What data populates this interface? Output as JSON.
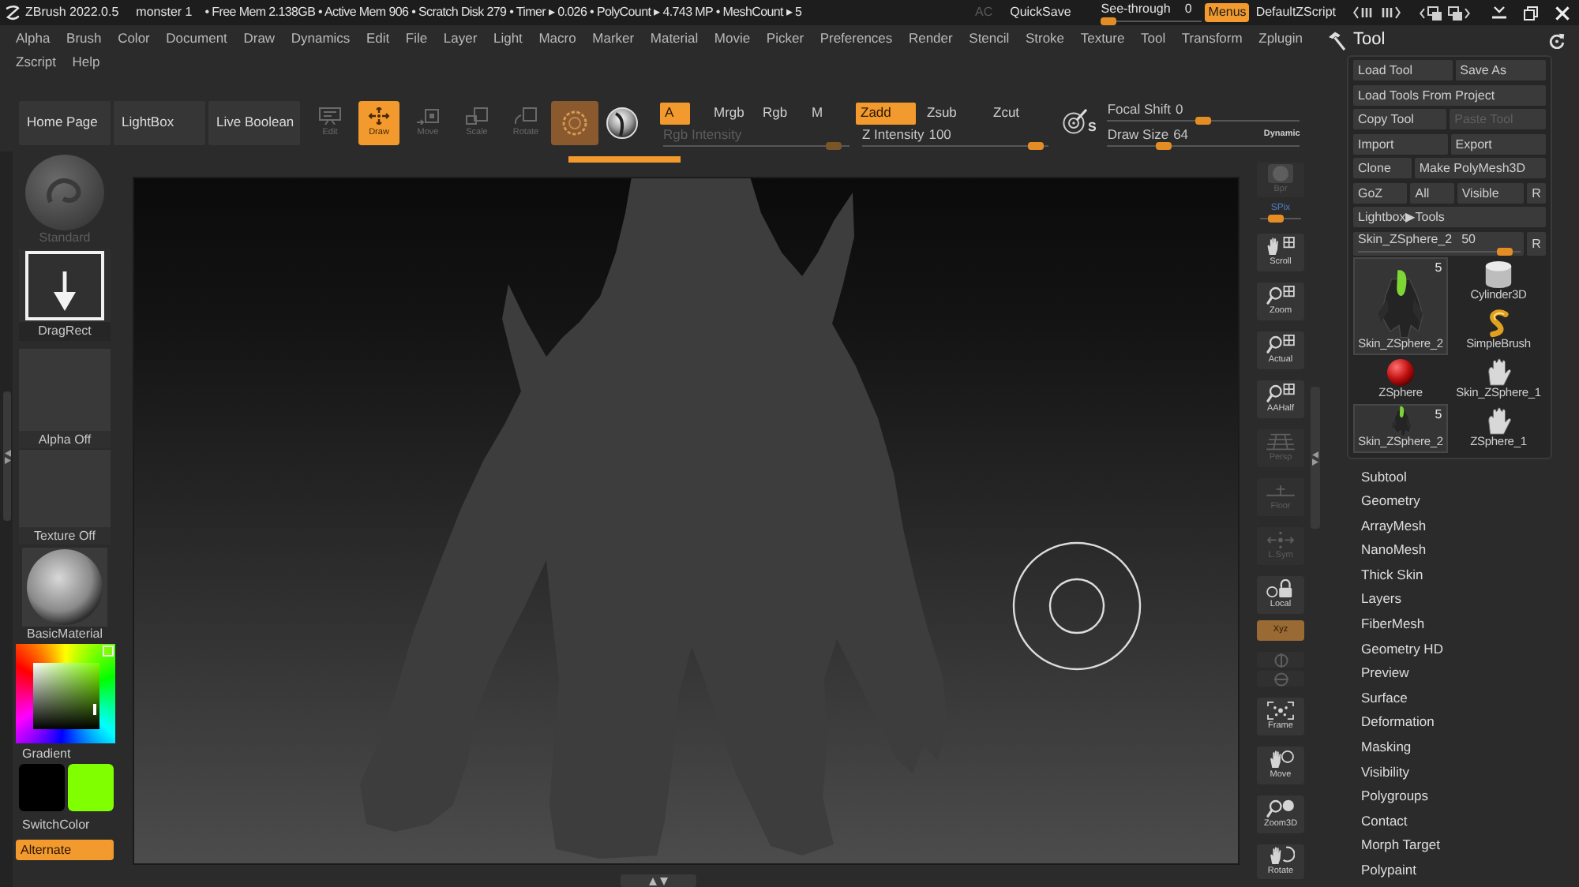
{
  "title_bar": {
    "app_name": "ZBrush 2022.0.5",
    "document": "monster 1",
    "stats": "• Free Mem 2.138GB • Active Mem 906 • Scratch Disk 279 • Timer ▸ 0.026 • PolyCount ▸ 4.743 MP • MeshCount ▸ 5",
    "controls": [
      {
        "kind": "button",
        "label": "AC",
        "disabled": true
      },
      {
        "kind": "button",
        "label": "QuickSave",
        "disabled": false
      },
      {
        "kind": "slider",
        "label": "See-through",
        "value": "0",
        "level": 0
      },
      {
        "kind": "toggle",
        "label": "Menus",
        "on": true
      },
      {
        "kind": "button",
        "label": "DefaultZScript",
        "disabled": false
      }
    ]
  },
  "menu_bar": {
    "rows": [
      [
        "Alpha",
        "Brush",
        "Color",
        "Document",
        "Draw",
        "Dynamics",
        "Edit",
        "File",
        "Layer",
        "Light",
        "Macro",
        "Marker",
        "Material",
        "Movie",
        "Picker",
        "Preferences",
        "Render",
        "Stencil",
        "Stroke",
        "Texture",
        "Tool",
        "Transform",
        "Zplugin"
      ],
      [
        "Zscript",
        "Help"
      ]
    ]
  },
  "toolbar": {
    "buttons": [
      "Home Page",
      "LightBox",
      "Live Boolean"
    ],
    "modes": [
      {
        "kind": "edit",
        "label": "Edit",
        "selected": false
      },
      {
        "kind": "draw",
        "label": "Draw",
        "selected": true
      },
      {
        "kind": "move",
        "label": "Move",
        "selected": false
      },
      {
        "kind": "scale",
        "label": "Scale",
        "selected": false
      },
      {
        "kind": "rotate",
        "label": "Rotate",
        "selected": false
      }
    ],
    "ring_toggle": {
      "on": true
    },
    "channels": [
      {
        "label": "A",
        "selected": true
      },
      {
        "label": "Mrgb",
        "selected": false
      },
      {
        "label": "Rgb",
        "selected": false
      },
      {
        "label": "M",
        "selected": false
      }
    ],
    "z_modes": [
      {
        "label": "Zadd",
        "selected": true
      },
      {
        "label": "Zsub",
        "selected": false
      },
      {
        "label": "Zcut",
        "selected": false
      }
    ],
    "intensity_sliders": [
      {
        "label": "Rgb Intensity",
        "disabled": true,
        "level": 0.95
      },
      {
        "label": "Z Intensity",
        "value": "100",
        "disabled": false,
        "level": 0.97
      }
    ],
    "brush_settings_label": "S",
    "brush_sliders": [
      {
        "label": "Focal Shift",
        "value": "0",
        "level": 0.5
      },
      {
        "label": "Draw Size",
        "value": "64",
        "level": 0.27
      }
    ],
    "dynamic_label": "Dynamic"
  },
  "left_panel": {
    "brush": {
      "label": "Standard",
      "disabled": true
    },
    "stroke": {
      "label": "DragRect"
    },
    "alpha": {
      "label": "Alpha Off"
    },
    "texture": {
      "label": "Texture Off"
    },
    "material": {
      "label": "BasicMaterial"
    },
    "gradient_label": "Gradient",
    "swatches": [
      {
        "color": "#000000"
      },
      {
        "color": "#80ff00"
      }
    ],
    "switch_label": "SwitchColor",
    "alternate": {
      "label": "Alternate",
      "on": true
    }
  },
  "right_shelf": [
    {
      "kind": "bpr",
      "label": "Bpr",
      "disabled": true,
      "on": false
    },
    {
      "kind": "spix",
      "label": "SPix",
      "level": 0.3,
      "disabled": false,
      "on": false
    },
    {
      "kind": "scroll",
      "label": "Scroll",
      "disabled": false,
      "on": false
    },
    {
      "kind": "zoom",
      "label": "Zoom",
      "disabled": false,
      "on": false
    },
    {
      "kind": "actual",
      "label": "Actual",
      "disabled": false,
      "on": false
    },
    {
      "kind": "aahalf",
      "label": "AAHalf",
      "disabled": false,
      "on": false
    },
    {
      "kind": "persp",
      "label": "Persp",
      "disabled": true,
      "on": false
    },
    {
      "kind": "floor",
      "label": "Floor",
      "disabled": true,
      "on": false
    },
    {
      "kind": "lsym",
      "label": "L.Sym",
      "disabled": true,
      "on": false
    },
    {
      "kind": "lock",
      "label": "Local",
      "disabled": false,
      "on": false
    },
    {
      "kind": "xyz",
      "label": "Xyz",
      "disabled": false,
      "on": true
    },
    {
      "kind": "yrot",
      "disabled": true,
      "on": false
    },
    {
      "kind": "zrot",
      "disabled": true,
      "on": false
    },
    {
      "kind": "frame",
      "label": "Frame",
      "disabled": false,
      "on": false
    },
    {
      "kind": "move",
      "label": "Move",
      "disabled": false,
      "on": false
    },
    {
      "kind": "zoom3d",
      "label": "Zoom3D",
      "disabled": false,
      "on": false
    },
    {
      "kind": "rotate",
      "label": "Rotate",
      "disabled": false,
      "on": false
    }
  ],
  "tool_panel": {
    "title": "Tool",
    "button_rows": [
      [
        {
          "label": "Load Tool",
          "disabled": false
        },
        {
          "label": "Save As",
          "disabled": false
        }
      ],
      [
        {
          "label": "Load Tools From Project",
          "disabled": false
        }
      ],
      [
        {
          "label": "Copy Tool",
          "disabled": false
        },
        {
          "label": "Paste Tool",
          "disabled": true
        }
      ],
      [
        {
          "label": "Import",
          "disabled": false
        },
        {
          "label": "Export",
          "disabled": false
        }
      ],
      [
        {
          "label": "Clone",
          "disabled": false
        },
        {
          "label": "Make PolyMesh3D",
          "disabled": false
        }
      ],
      [
        {
          "label": "GoZ",
          "disabled": false
        },
        {
          "label": "All",
          "disabled": false
        },
        {
          "label": "Visible",
          "disabled": false
        },
        {
          "label": "R",
          "disabled": false
        }
      ],
      [
        {
          "label": "Lightbox▶Tools",
          "disabled": false
        }
      ]
    ],
    "tool_slider": {
      "label": "Skin_ZSphere_2",
      "value": "50",
      "level": 0.95,
      "reset_label": "R"
    },
    "tools": [
      {
        "kind": "figure",
        "label": "Skin_ZSphere_2",
        "count": "5",
        "selected": true,
        "highlighted": true
      },
      {
        "kind": "cylinder",
        "label": "Cylinder3D",
        "selected": false,
        "highlighted": false
      },
      {
        "kind": "curl",
        "label": "SimpleBrush",
        "selected": false,
        "highlighted": false
      },
      {
        "kind": "sphere",
        "label": "ZSphere",
        "selected": false,
        "highlighted": false
      },
      {
        "kind": "hand",
        "label": "Skin_ZSphere_1",
        "selected": false,
        "highlighted": false
      },
      {
        "kind": "figure",
        "label": "Skin_ZSphere_2",
        "count": "5",
        "selected": false,
        "highlighted": true
      },
      {
        "kind": "hand",
        "label": "ZSphere_1",
        "selected": false,
        "highlighted": false
      }
    ],
    "subpalettes": [
      "Subtool",
      "Geometry",
      "ArrayMesh",
      "NanoMesh",
      "Thick Skin",
      "Layers",
      "FiberMesh",
      "Geometry HD",
      "Preview",
      "Surface",
      "Deformation",
      "Masking",
      "Visibility",
      "Polygroups",
      "Contact",
      "Morph Target",
      "Polypaint"
    ]
  }
}
